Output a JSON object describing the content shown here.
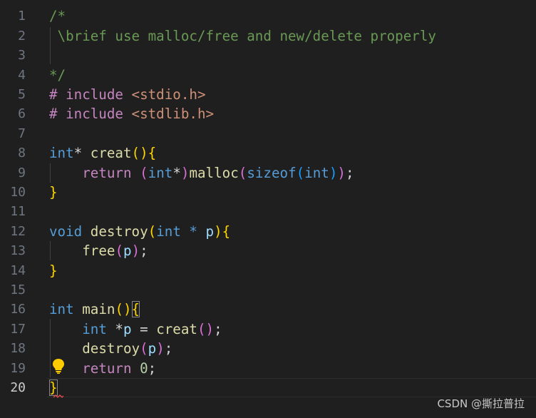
{
  "editor": {
    "current_line": 20,
    "lines": [
      {
        "n": "1",
        "tokens": [
          {
            "t": "/*",
            "c": "comment"
          }
        ]
      },
      {
        "n": "2",
        "tokens": [
          {
            "t": " \\brief use malloc/free and new/delete properly",
            "c": "comment"
          }
        ]
      },
      {
        "n": "3",
        "tokens": []
      },
      {
        "n": "4",
        "tokens": [
          {
            "t": "*/",
            "c": "comment"
          }
        ]
      },
      {
        "n": "5",
        "tokens": [
          {
            "t": "# include ",
            "c": "directive"
          },
          {
            "t": "<stdio.h>",
            "c": "string"
          }
        ]
      },
      {
        "n": "6",
        "tokens": [
          {
            "t": "# include ",
            "c": "directive"
          },
          {
            "t": "<stdlib.h>",
            "c": "string"
          }
        ]
      },
      {
        "n": "7",
        "tokens": []
      },
      {
        "n": "8",
        "tokens": [
          {
            "t": "int",
            "c": "keyword"
          },
          {
            "t": "* ",
            "c": "op"
          },
          {
            "t": "creat",
            "c": "func"
          },
          {
            "t": "()",
            "c": "b1"
          },
          {
            "t": "{",
            "c": "b1"
          }
        ]
      },
      {
        "n": "9",
        "tokens": [
          {
            "t": "    ",
            "c": "op"
          },
          {
            "t": "return",
            "c": "control"
          },
          {
            "t": " ",
            "c": "op"
          },
          {
            "t": "(",
            "c": "b2"
          },
          {
            "t": "int",
            "c": "keyword"
          },
          {
            "t": "*",
            "c": "op"
          },
          {
            "t": ")",
            "c": "b2"
          },
          {
            "t": "malloc",
            "c": "func"
          },
          {
            "t": "(",
            "c": "b2"
          },
          {
            "t": "sizeof",
            "c": "keyword"
          },
          {
            "t": "(",
            "c": "b3"
          },
          {
            "t": "int",
            "c": "keyword"
          },
          {
            "t": ")",
            "c": "b3"
          },
          {
            "t": ")",
            "c": "b2"
          },
          {
            "t": ";",
            "c": "op"
          }
        ]
      },
      {
        "n": "10",
        "tokens": [
          {
            "t": "}",
            "c": "b1"
          }
        ]
      },
      {
        "n": "11",
        "tokens": []
      },
      {
        "n": "12",
        "tokens": [
          {
            "t": "void",
            "c": "keyword"
          },
          {
            "t": " ",
            "c": "op"
          },
          {
            "t": "destroy",
            "c": "func"
          },
          {
            "t": "(",
            "c": "b1"
          },
          {
            "t": "int",
            "c": "keyword"
          },
          {
            "t": " * ",
            "c": "keyword"
          },
          {
            "t": "p",
            "c": "var"
          },
          {
            "t": ")",
            "c": "b1"
          },
          {
            "t": "{",
            "c": "b1"
          }
        ]
      },
      {
        "n": "13",
        "tokens": [
          {
            "t": "    ",
            "c": "op"
          },
          {
            "t": "free",
            "c": "func"
          },
          {
            "t": "(",
            "c": "b2"
          },
          {
            "t": "p",
            "c": "var"
          },
          {
            "t": ")",
            "c": "b2"
          },
          {
            "t": ";",
            "c": "op"
          }
        ]
      },
      {
        "n": "14",
        "tokens": [
          {
            "t": "}",
            "c": "b1"
          }
        ]
      },
      {
        "n": "15",
        "tokens": []
      },
      {
        "n": "16",
        "tokens": [
          {
            "t": "int",
            "c": "keyword"
          },
          {
            "t": " ",
            "c": "op"
          },
          {
            "t": "main",
            "c": "func"
          },
          {
            "t": "()",
            "c": "b1"
          },
          {
            "t": "{",
            "c": "b1 boxed"
          }
        ]
      },
      {
        "n": "17",
        "tokens": [
          {
            "t": "    ",
            "c": "op"
          },
          {
            "t": "int",
            "c": "keyword"
          },
          {
            "t": " *",
            "c": "op"
          },
          {
            "t": "p",
            "c": "var"
          },
          {
            "t": " = ",
            "c": "op"
          },
          {
            "t": "creat",
            "c": "func"
          },
          {
            "t": "()",
            "c": "b2"
          },
          {
            "t": ";",
            "c": "op"
          }
        ]
      },
      {
        "n": "18",
        "tokens": [
          {
            "t": "    ",
            "c": "op"
          },
          {
            "t": "destroy",
            "c": "func"
          },
          {
            "t": "(",
            "c": "b2"
          },
          {
            "t": "p",
            "c": "var"
          },
          {
            "t": ")",
            "c": "b2"
          },
          {
            "t": ";",
            "c": "op"
          }
        ]
      },
      {
        "n": "19",
        "tokens": [
          {
            "t": "    ",
            "c": "op"
          },
          {
            "t": "return",
            "c": "control"
          },
          {
            "t": " ",
            "c": "op"
          },
          {
            "t": "0",
            "c": "number"
          },
          {
            "t": ";",
            "c": "op"
          }
        ]
      },
      {
        "n": "20",
        "tokens": [
          {
            "t": "}",
            "c": "b1 boxed"
          }
        ]
      }
    ]
  },
  "lightbulb_icon": "lightbulb-icon",
  "watermark": "CSDN @撕拉普拉"
}
